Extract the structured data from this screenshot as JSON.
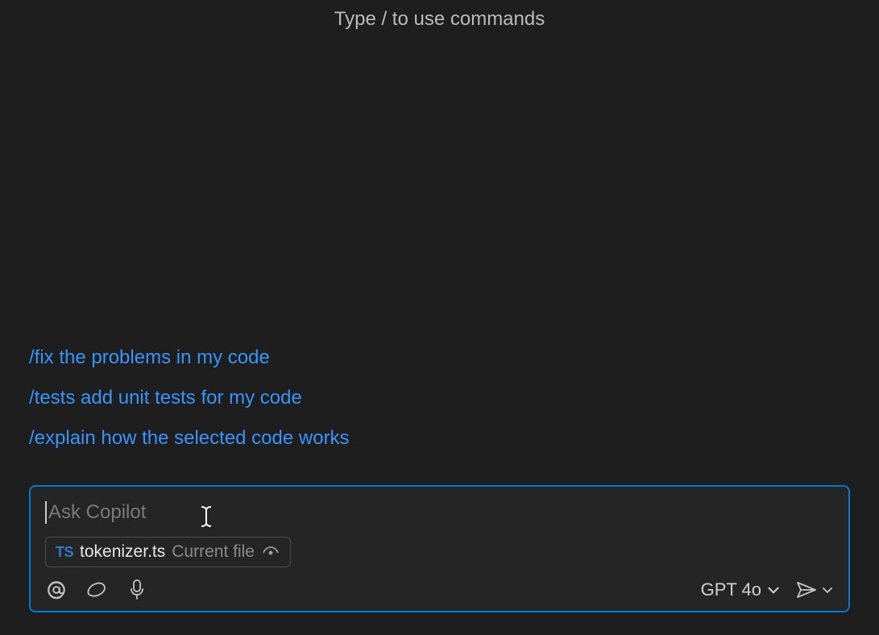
{
  "hint": "Type / to use commands",
  "suggestions": [
    {
      "text": "/fix the problems in my code"
    },
    {
      "text": "/tests add unit tests for my code"
    },
    {
      "text": "/explain how the selected code works"
    }
  ],
  "input": {
    "placeholder": "Ask Copilot"
  },
  "attachment": {
    "type_badge": "TS",
    "filename": "tokenizer.ts",
    "hint": "Current file"
  },
  "model": {
    "selected": "GPT 4o"
  }
}
